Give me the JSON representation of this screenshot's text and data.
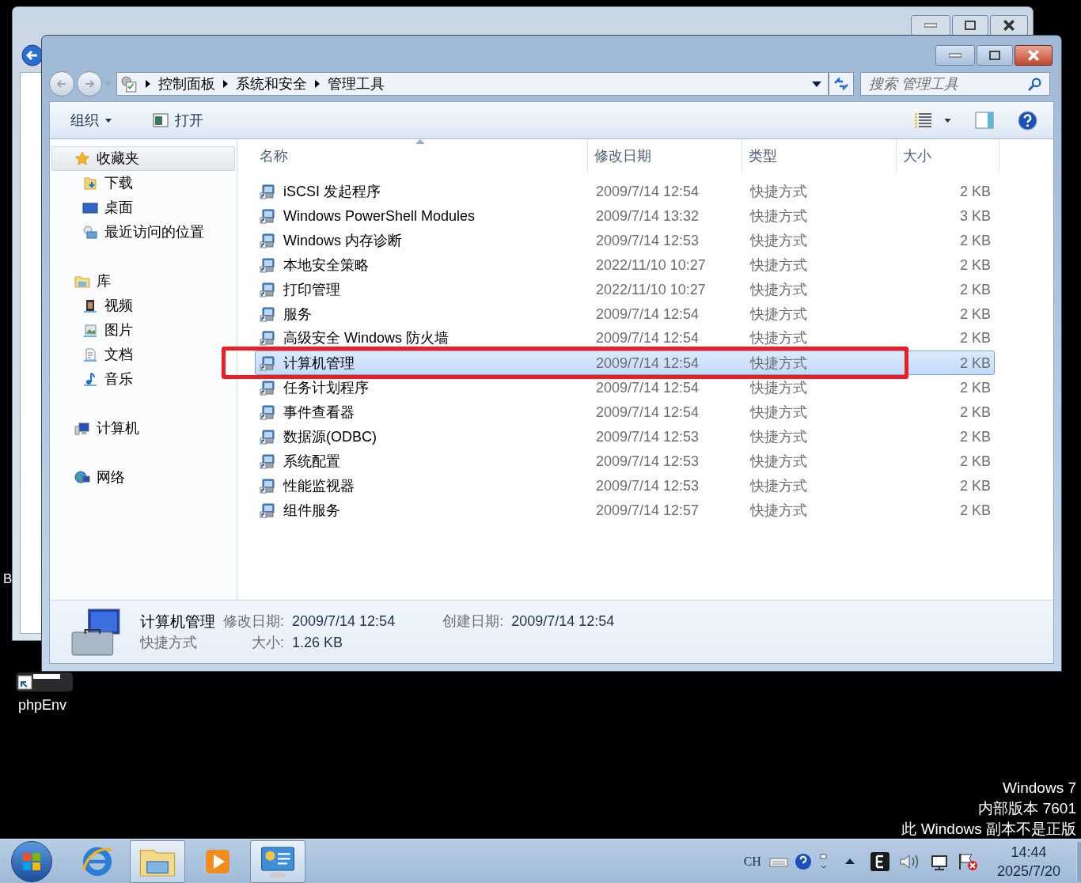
{
  "desktop": {
    "partial_label": "B",
    "shortcut": {
      "label": "phpEnv"
    },
    "watermark": [
      "Windows 7",
      "内部版本 7601",
      "此 Windows 副本不是正版"
    ]
  },
  "window": {
    "breadcrumb": [
      "控制面板",
      "系统和安全",
      "管理工具"
    ],
    "search": {
      "placeholder": "搜索 管理工具"
    },
    "toolbar": [
      {
        "label": "组织",
        "kind": "menu"
      },
      {
        "label": "打开",
        "kind": "action"
      }
    ],
    "sidebar": [
      {
        "label": "收藏夹",
        "selected": true,
        "children": [
          {
            "label": "下载",
            "selected": false
          },
          {
            "label": "桌面",
            "selected": false
          },
          {
            "label": "最近访问的位置",
            "selected": false
          }
        ]
      },
      {
        "label": "库",
        "selected": false,
        "children": [
          {
            "label": "视频",
            "selected": false
          },
          {
            "label": "图片",
            "selected": false
          },
          {
            "label": "文档",
            "selected": false
          },
          {
            "label": "音乐",
            "selected": false
          }
        ]
      },
      {
        "label": "计算机",
        "selected": false
      },
      {
        "label": "网络",
        "selected": false
      }
    ],
    "columns": [
      {
        "label": "名称",
        "sorted": true
      },
      {
        "label": "修改日期",
        "sorted": false
      },
      {
        "label": "类型",
        "sorted": false
      },
      {
        "label": "大小",
        "sorted": false
      }
    ],
    "files": [
      {
        "name": "iSCSI 发起程序",
        "date": "2009/7/14 12:54",
        "type": "快捷方式",
        "size": "2 KB",
        "selected": false
      },
      {
        "name": "Windows PowerShell Modules",
        "date": "2009/7/14 13:32",
        "type": "快捷方式",
        "size": "3 KB",
        "selected": false
      },
      {
        "name": "Windows 内存诊断",
        "date": "2009/7/14 12:53",
        "type": "快捷方式",
        "size": "2 KB",
        "selected": false
      },
      {
        "name": "本地安全策略",
        "date": "2022/11/10 10:27",
        "type": "快捷方式",
        "size": "2 KB",
        "selected": false
      },
      {
        "name": "打印管理",
        "date": "2022/11/10 10:27",
        "type": "快捷方式",
        "size": "2 KB",
        "selected": false
      },
      {
        "name": "服务",
        "date": "2009/7/14 12:54",
        "type": "快捷方式",
        "size": "2 KB",
        "selected": false
      },
      {
        "name": "高级安全 Windows 防火墙",
        "date": "2009/7/14 12:54",
        "type": "快捷方式",
        "size": "2 KB",
        "selected": false
      },
      {
        "name": "计算机管理",
        "date": "2009/7/14 12:54",
        "type": "快捷方式",
        "size": "2 KB",
        "selected": true
      },
      {
        "name": "任务计划程序",
        "date": "2009/7/14 12:54",
        "type": "快捷方式",
        "size": "2 KB",
        "selected": false
      },
      {
        "name": "事件查看器",
        "date": "2009/7/14 12:54",
        "type": "快捷方式",
        "size": "2 KB",
        "selected": false
      },
      {
        "name": "数据源(ODBC)",
        "date": "2009/7/14 12:53",
        "type": "快捷方式",
        "size": "2 KB",
        "selected": false
      },
      {
        "name": "系统配置",
        "date": "2009/7/14 12:53",
        "type": "快捷方式",
        "size": "2 KB",
        "selected": false
      },
      {
        "name": "性能监视器",
        "date": "2009/7/14 12:53",
        "type": "快捷方式",
        "size": "2 KB",
        "selected": false
      },
      {
        "name": "组件服务",
        "date": "2009/7/14 12:57",
        "type": "快捷方式",
        "size": "2 KB",
        "selected": false
      }
    ],
    "details": {
      "name": "计算机管理",
      "type": "快捷方式",
      "fields": [
        {
          "label": "修改日期:",
          "value": "2009/7/14 12:54"
        },
        {
          "label": "大小:",
          "value": "1.26 KB"
        },
        {
          "label": "创建日期:",
          "value": "2009/7/14 12:54"
        }
      ]
    }
  },
  "taskbar": {
    "items": [
      {
        "kind": "browser",
        "active": false
      },
      {
        "kind": "explorer",
        "active": true
      },
      {
        "kind": "media",
        "active": false
      },
      {
        "kind": "control-panel",
        "active": true
      }
    ],
    "tray": {
      "language": "CH",
      "time": "14:44",
      "date": "2025/7/20"
    }
  }
}
